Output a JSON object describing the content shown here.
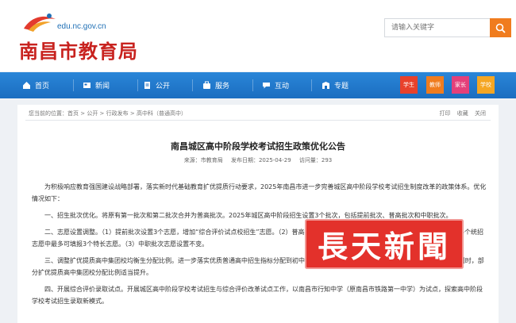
{
  "header": {
    "domain": "edu.nc.gov.cn",
    "site_title": "南昌市教育局",
    "search_placeholder": "请输入关键字",
    "search_icon": "search-icon"
  },
  "nav": {
    "items": [
      {
        "label": "首页",
        "icon": "home-icon"
      },
      {
        "label": "新闻",
        "icon": "news-icon"
      },
      {
        "label": "公开",
        "icon": "document-icon"
      },
      {
        "label": "服务",
        "icon": "service-icon"
      },
      {
        "label": "互动",
        "icon": "chat-icon"
      },
      {
        "label": "专题",
        "icon": "topic-icon"
      }
    ],
    "audiences": [
      {
        "label": "学生",
        "color": "#e8412b"
      },
      {
        "label": "教师",
        "color": "#f07c1e"
      },
      {
        "label": "家长",
        "color": "#e4407a"
      },
      {
        "label": "学校",
        "color": "#f5a623"
      }
    ]
  },
  "breadcrumb": "您当前的位置：首页 > 公开 > 行政发布 > 高中科（普通高中）",
  "tools": [
    "打印",
    "收藏",
    "关闭"
  ],
  "article": {
    "title": "南昌城区高中阶段学校考试招生政策优化公告",
    "source": "来源：市教育局",
    "date": "发布日期：2025-04-29",
    "views": "访问量：293",
    "paragraphs": [
      "为积极响应教育强国建设战略部署，落实新时代基础教育扩优提质行动要求，2025年南昌市进一步完善城区高中阶段学校考试招生制度改革的政策体系。优化情况如下：",
      "一、招生批次优化。将原有第一批次和第二批次合并为普高批次。2025年城区高中阶段招生设置3个批次，包括提前批次、普高批次和中职批次。",
      "二、志愿设置调整。（1）提前批次设置3个志愿，增加“综合评价试点校招生”志愿。（2）普高批次设置1个定向志愿和15个统招志愿，其中，考生在15个统招志愿中最多可填报3个特长志愿。（3）中职批次志愿设置不变。",
      "三、调整扩优提质高中集团校均衡生分配比例。进一步落实优质普通高中招生指标分配到初中学校政策，公办优质普通高中指标到校比例达到70%的同时，部分扩优提质高中集团校分配比例适当提升。",
      "四、开展综合评价录取试点。开展城区高中阶段学校考试招生与综合评价改革试点工作，以南昌市行知中学（原南昌市铁路第一中学）为试点，探索高中阶段学校考试招生录取新模式。"
    ]
  },
  "watermark": "長天新聞"
}
